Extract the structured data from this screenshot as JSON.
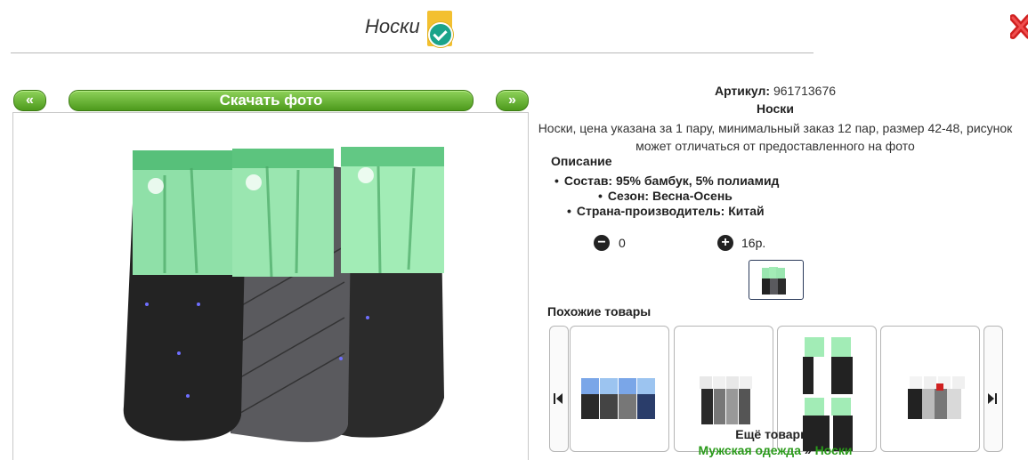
{
  "header": {
    "title": "Носки"
  },
  "gallery": {
    "prev_label": "«",
    "next_label": "»",
    "download_label": "Скачать фото"
  },
  "product": {
    "article_label": "Артикул:",
    "article_value": "961713676",
    "name": "Носки",
    "description": "Носки, цена указана за 1 пару, минимальный заказ 12 пар, размер 42-48, рисунок может отличаться от предоставленного на фото",
    "section_label": "Описание",
    "specs": [
      "Состав: 95% бамбук, 5% полиамид",
      "Сезон: Весна-Осень",
      "Страна-производитель: Китай"
    ],
    "quantity": "0",
    "price": "16р."
  },
  "similar": {
    "label": "Похожие товары"
  },
  "more": {
    "label": "Ещё товары:",
    "crumb_1": "Мужская одежда",
    "separator": "»",
    "crumb_2": "Носки"
  },
  "colors": {
    "accent_green": "#4d9a1c",
    "link_green": "#2a9a1a",
    "close_red": "#d02020",
    "badge_yellow": "#f3c030",
    "badge_teal": "#1aa38a"
  },
  "icons": {
    "verified": "verified-icon",
    "close": "close-icon",
    "minus": "minus-circle-icon",
    "plus": "plus-circle-icon",
    "prev": "skip-back-icon",
    "next": "skip-forward-icon"
  }
}
